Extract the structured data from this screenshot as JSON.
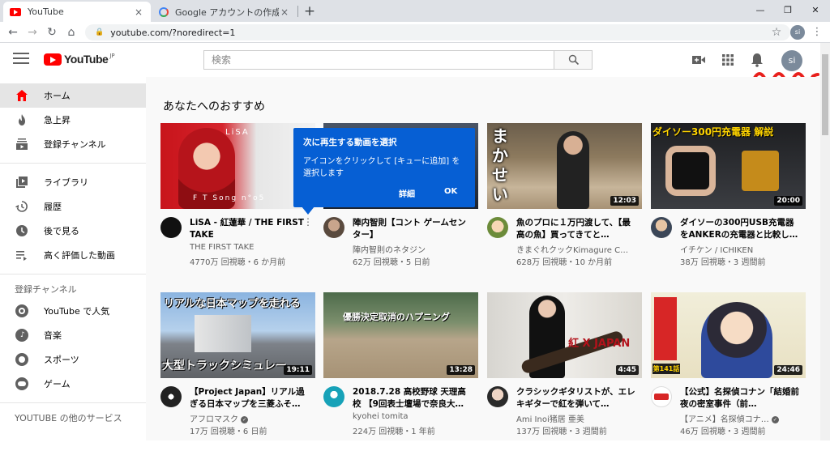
{
  "browser": {
    "tabs": [
      {
        "title": "YouTube",
        "active": true
      },
      {
        "title": "Google アカウントの作成時に個人情",
        "active": false
      }
    ],
    "url": "youtube.com/?noredirect=1",
    "profile_initials": "si",
    "close_glyph": "×",
    "newtab_glyph": "+",
    "back_glyph": "←",
    "forward_glyph": "→",
    "reload_glyph": "↻",
    "home_glyph": "⌂",
    "lock_glyph": "🔒",
    "star_glyph": "☆",
    "menu_glyph": "⋮",
    "window_controls": {
      "minimize": "—",
      "restore": "❐",
      "close": "✕"
    }
  },
  "header": {
    "logo_text": "YouTube",
    "logo_region": "JP",
    "search_placeholder": "検索",
    "avatar_initials": "si",
    "accent_color": "#ff0000",
    "annotation_color": "#e8201c"
  },
  "sidebar": {
    "primary": [
      {
        "label": "ホーム",
        "icon": "home-icon",
        "active": true
      },
      {
        "label": "急上昇",
        "icon": "flame-icon",
        "active": false
      },
      {
        "label": "登録チャンネル",
        "icon": "subscriptions-icon",
        "active": false
      }
    ],
    "library": [
      {
        "label": "ライブラリ",
        "icon": "library-icon"
      },
      {
        "label": "履歴",
        "icon": "history-icon"
      },
      {
        "label": "後で見る",
        "icon": "clock-icon"
      },
      {
        "label": "高く評価した動画",
        "icon": "list-icon"
      }
    ],
    "subscriptions_heading": "登録チャンネル",
    "subscriptions": [
      {
        "label": "YouTube で人気",
        "icon": "youtube-popular-icon"
      },
      {
        "label": "音楽",
        "icon": "music-icon"
      },
      {
        "label": "スポーツ",
        "icon": "sports-icon"
      },
      {
        "label": "ゲーム",
        "icon": "gaming-icon"
      }
    ],
    "more_heading": "YOUTUBE の他のサービス"
  },
  "main": {
    "section_title": "あなたへのおすすめ",
    "videos": [
      {
        "title": "LiSA - 紅蓮華 / THE FIRST TAKE",
        "channel": "THE FIRST TAKE",
        "stats": "4770万 回視聴・6 か月前",
        "duration": "",
        "verified": false
      },
      {
        "title": "陣内智則【コント ゲームセンター】",
        "channel": "陣内智則のネタジン",
        "stats": "62万 回視聴・5 日前",
        "duration": "",
        "verified": false
      },
      {
        "title": "魚のプロに１万円渡して、【最高の魚】買ってきてと…",
        "channel": "きまぐれクックKimagure C…",
        "stats": "628万 回視聴・10 か月前",
        "duration": "12:03",
        "verified": false
      },
      {
        "title": "ダイソーの300円USB充電器をANKERの充電器と比較し…",
        "channel": "イチケン / ICHIKEN",
        "stats": "38万 回視聴・3 週間前",
        "duration": "20:00",
        "verified": false
      },
      {
        "title": "【Project Japan】リアル過ぎる日本マップを三菱ふそ…",
        "channel": "アフロマスク",
        "stats": "17万 回視聴・6 日前",
        "duration": "19:11",
        "verified": true
      },
      {
        "title": "2018.7.28 高校野球 天理高校 【9回表士壇場で奈良大…",
        "channel": "kyohei tomita",
        "stats": "224万 回視聴・1 年前",
        "duration": "13:28",
        "verified": false
      },
      {
        "title": "クラシックギタリストが、エレキギターで紅を弾いて…",
        "channel": "Ami Inoi猪居 亜美",
        "stats": "137万 回視聴・3 週間前",
        "duration": "4:45",
        "verified": false
      },
      {
        "title": "【公式】名探偵コナン「結婚前夜の密室事件（前…",
        "channel": "【アニメ】名探偵コナ…",
        "stats": "46万 回視聴・3 週間前",
        "duration": "24:46",
        "verified": true
      }
    ],
    "thumb_texts": {
      "lisa_brand": "LiSA",
      "lisa_caption": "F T Song n°o5",
      "makasei": "まかせい",
      "daiso": "ダイソー300円充電器 解説",
      "map_title": "リアルな日本マップを走れる",
      "map_sub": "大型トラックシミュレー",
      "baseball": "優勝決定取消のハプニング",
      "xjapan": "紅 X JAPAN",
      "conan_ep": "第141話"
    }
  },
  "tooltip": {
    "title": "次に再生する動画を選択",
    "body": "アイコンをクリックして [キューに追加] を選択します",
    "details_label": "詳細",
    "ok_label": "OK",
    "color": "#065fd4"
  }
}
